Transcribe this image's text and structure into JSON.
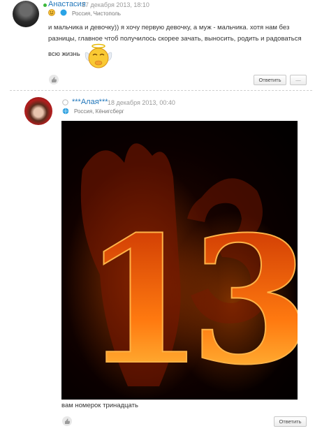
{
  "comment1": {
    "author": "Анастасия",
    "date": "17 декабря 2013, 18:10",
    "location": "Россия, Чистополь",
    "text_line1": "и мальчика и девочку)) я хочу первую девочку, а муж - мальчика. хотя нам без",
    "text_line2": "разницы, главное чтоб получилось скорее зачать, выносить, родить и радоваться",
    "text_line3": "всю жизнь",
    "reply_label": "Ответить",
    "more_label": "—"
  },
  "comment2": {
    "author": "***Алая***",
    "date": "18 декабря 2013, 00:40",
    "location": "Россия, Кёнигсберг",
    "caption": "вам номерок тринадцать",
    "image_text": "13",
    "reply_label": "Ответить"
  },
  "colors": {
    "link": "#2277bb",
    "online": "#3cb83c",
    "fire_orange": "#ff6a00",
    "fire_yellow": "#ffd24a"
  }
}
